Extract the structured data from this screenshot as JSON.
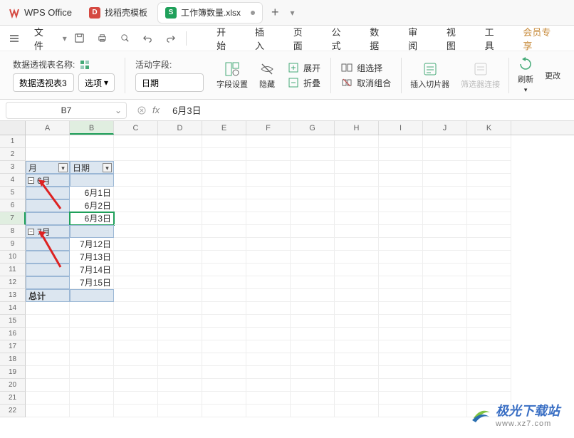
{
  "app": {
    "name": "WPS Office"
  },
  "tabs": [
    {
      "label": "找稻壳模板",
      "icon": "doc"
    },
    {
      "label": "工作簿数量.xlsx",
      "icon": "xls",
      "active": true
    }
  ],
  "file_menu": "文件",
  "menu_items": [
    "开始",
    "插入",
    "页面",
    "公式",
    "数据",
    "审阅",
    "视图",
    "工具",
    "会员专享"
  ],
  "ribbon": {
    "pivot_name_label": "数据透视表名称:",
    "pivot_name_value": "数据透视表3",
    "options_btn": "选项",
    "active_field_label": "活动字段:",
    "active_field_value": "日期",
    "field_settings": "字段设置",
    "hide": "隐藏",
    "expand": "展开",
    "collapse": "折叠",
    "group_select": "组选择",
    "ungroup": "取消组合",
    "insert_slicer": "插入切片器",
    "filter_conn": "筛选器连接",
    "refresh": "刷新",
    "change": "更改"
  },
  "formula_bar": {
    "cell_ref": "B7",
    "value": "6月3日"
  },
  "columns": [
    "A",
    "B",
    "C",
    "D",
    "E",
    "F",
    "G",
    "H",
    "I",
    "J",
    "K"
  ],
  "pivot": {
    "row_field": "月",
    "col_field": "日期",
    "groups": [
      {
        "name": "6月",
        "items": [
          "6月1日",
          "6月2日",
          "6月3日"
        ]
      },
      {
        "name": "7月",
        "items": [
          "7月12日",
          "7月13日",
          "7月14日",
          "7月15日"
        ]
      }
    ],
    "total_label": "总计"
  },
  "chart_data": {
    "type": "table",
    "title": "数据透视表3",
    "row_field": "月",
    "value_field": "日期",
    "rows": [
      {
        "月": "6月",
        "日期": [
          "6月1日",
          "6月2日",
          "6月3日"
        ]
      },
      {
        "月": "7月",
        "日期": [
          "7月12日",
          "7月13日",
          "7月14日",
          "7月15日"
        ]
      }
    ]
  },
  "watermark": {
    "name": "极光下载站",
    "url": "www.xz7.com"
  }
}
